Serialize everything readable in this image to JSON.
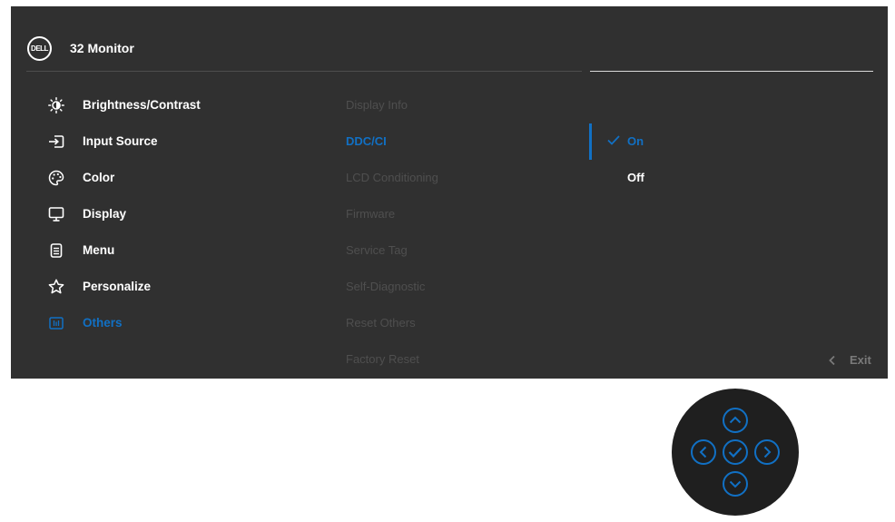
{
  "header": {
    "logo_text": "DELL",
    "title": "32 Monitor"
  },
  "menu": [
    {
      "label": "Brightness/Contrast",
      "icon": "brightness-icon",
      "active": false
    },
    {
      "label": "Input Source",
      "icon": "input-source-icon",
      "active": false
    },
    {
      "label": "Color",
      "icon": "palette-icon",
      "active": false
    },
    {
      "label": "Display",
      "icon": "display-icon",
      "active": false
    },
    {
      "label": "Menu",
      "icon": "menu-icon",
      "active": false
    },
    {
      "label": "Personalize",
      "icon": "star-icon",
      "active": false
    },
    {
      "label": "Others",
      "icon": "others-icon",
      "active": true
    }
  ],
  "submenu": [
    {
      "label": "Display Info",
      "active": false
    },
    {
      "label": "DDC/CI",
      "active": true
    },
    {
      "label": "LCD Conditioning",
      "active": false
    },
    {
      "label": "Firmware",
      "active": false
    },
    {
      "label": "Service Tag",
      "active": false
    },
    {
      "label": "Self-Diagnostic",
      "active": false
    },
    {
      "label": "Reset Others",
      "active": false
    },
    {
      "label": "Factory Reset",
      "active": false
    }
  ],
  "options": [
    {
      "label": "On",
      "selected": true
    },
    {
      "label": "Off",
      "selected": false
    }
  ],
  "exit": {
    "label": "Exit"
  },
  "joystick": {
    "buttons": [
      "up",
      "left",
      "ok",
      "right",
      "down"
    ]
  },
  "colors": {
    "background": "#303030",
    "accent": "#1170c4",
    "text": "#ffffff",
    "dim_text": "#4f4f4f"
  }
}
